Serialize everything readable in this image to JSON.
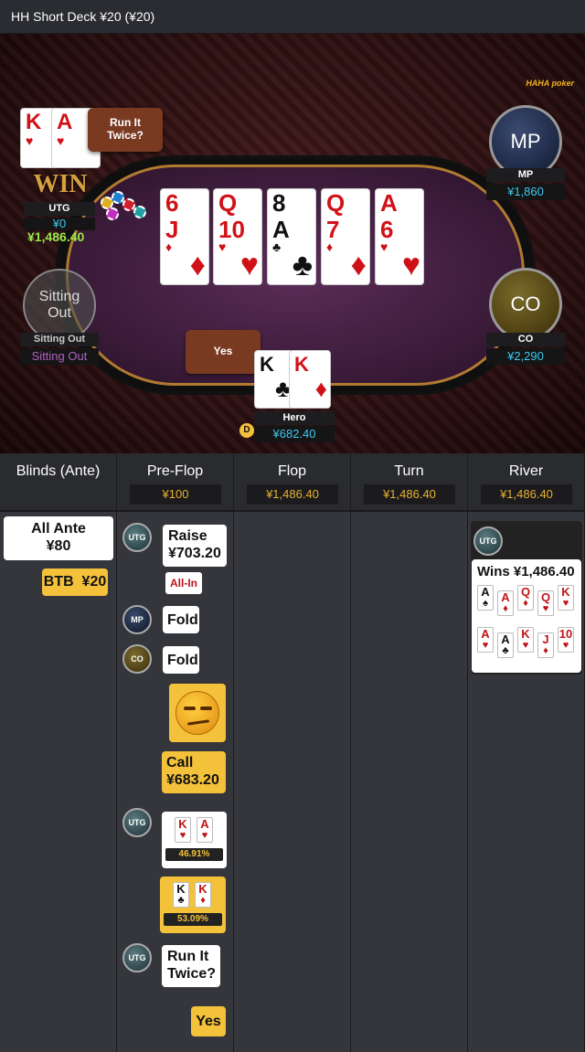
{
  "header": {
    "title": "HH  Short Deck ¥20 (¥20)"
  },
  "logo": {
    "text": "HAHA poker"
  },
  "board": [
    {
      "r1": "6",
      "r2": "J",
      "suit": "♦",
      "color": "red"
    },
    {
      "r1": "Q",
      "r2": "10",
      "suit": "♥",
      "color": "red"
    },
    {
      "r1": "8",
      "r2": "A",
      "suit": "♣",
      "color": "blk"
    },
    {
      "r1": "Q",
      "r2": "7",
      "suit": "♦",
      "color": "red"
    },
    {
      "r1": "A",
      "r2": "6",
      "suit": "♥",
      "color": "red"
    }
  ],
  "seats": {
    "utg": {
      "name": "UTG",
      "stack": "¥0",
      "win_amount": "¥1,486.40",
      "cards": [
        "K",
        "A"
      ],
      "win_label": "WIN",
      "bubble": "Run It Twice?"
    },
    "mp": {
      "avatar": "MP",
      "name": "MP",
      "stack": "¥1,860"
    },
    "co": {
      "avatar": "CO",
      "name": "CO",
      "stack": "¥2,290"
    },
    "sitting": {
      "avatar": "Sitting Out",
      "name": "Sitting Out",
      "stack": "Sitting Out"
    },
    "hero": {
      "name": "Hero",
      "stack": "¥682.40",
      "cards": [
        "K",
        "K"
      ],
      "bubble": "Yes",
      "dealer": "D"
    }
  },
  "streets": [
    {
      "label": "Blinds (Ante)",
      "pot": ""
    },
    {
      "label": "Pre-Flop",
      "pot": "¥100"
    },
    {
      "label": "Flop",
      "pot": "¥1,486.40"
    },
    {
      "label": "Turn",
      "pot": "¥1,486.40"
    },
    {
      "label": "River",
      "pot": "¥1,486.40"
    }
  ],
  "actions": {
    "all_ante": "All Ante\n¥80",
    "btb": "BTB  ¥20",
    "utg_raise": "Raise\n¥703.20",
    "all_in": "All-In",
    "mp_fold": "Fold",
    "co_fold": "Fold",
    "hero_call": "Call\n¥683.20",
    "utg_equity": "46.91%",
    "hero_equity": "53.09%",
    "utg_rit": "Run It\nTwice?",
    "hero_yes": "Yes",
    "river_wins": "Wins ¥1,486.40"
  },
  "avatars": {
    "utg": "UTG",
    "mp": "MP",
    "co": "CO"
  },
  "river_hands": {
    "row1": [
      {
        "r": "A",
        "s": "♠",
        "c": "blk"
      },
      {
        "r": "A",
        "s": "♦",
        "c": "red"
      },
      {
        "r": "Q",
        "s": "♦",
        "c": "red"
      },
      {
        "r": "Q",
        "s": "♥",
        "c": "red"
      },
      {
        "r": "K",
        "s": "♥",
        "c": "red"
      }
    ],
    "row2": [
      {
        "r": "A",
        "s": "♥",
        "c": "red"
      },
      {
        "r": "A",
        "s": "♣",
        "c": "blk"
      },
      {
        "r": "K",
        "s": "♥",
        "c": "red"
      },
      {
        "r": "J",
        "s": "♦",
        "c": "red"
      },
      {
        "r": "10",
        "s": "♥",
        "c": "red"
      }
    ]
  },
  "colors": {
    "gold": "#f4c23a",
    "stack_cyan": "#3ec8f0",
    "win_green": "#9be84a",
    "sitting_purple": "#b060c0"
  }
}
